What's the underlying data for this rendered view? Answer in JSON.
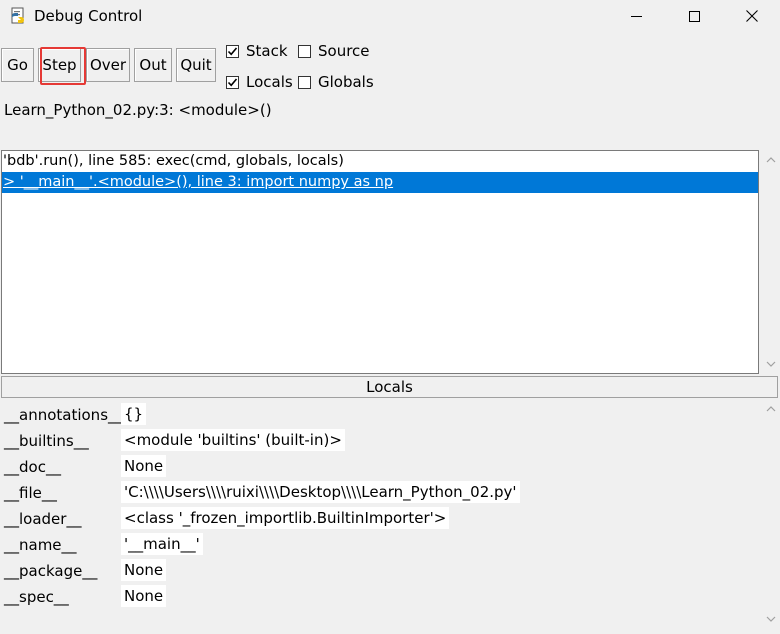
{
  "window": {
    "title": "Debug Control",
    "controls": [
      "minimize",
      "maximize",
      "close"
    ]
  },
  "toolbar": {
    "buttons": [
      {
        "id": "go",
        "label": "Go"
      },
      {
        "id": "step",
        "label": "Step",
        "highlighted": true
      },
      {
        "id": "over",
        "label": "Over"
      },
      {
        "id": "out",
        "label": "Out"
      },
      {
        "id": "quit",
        "label": "Quit"
      }
    ],
    "checkboxes": [
      {
        "id": "stack",
        "label": "Stack",
        "checked": true
      },
      {
        "id": "source",
        "label": "Source",
        "checked": false
      },
      {
        "id": "locals",
        "label": "Locals",
        "checked": true
      },
      {
        "id": "globals",
        "label": "Globals",
        "checked": false
      }
    ]
  },
  "status": "Learn_Python_02.py:3: <module>()",
  "stack": [
    {
      "text": "'bdb'.run(), line 585: exec(cmd, globals, locals)",
      "selected": false
    },
    {
      "text": "> '__main__'.<module>(), line 3: import numpy as np",
      "selected": true
    }
  ],
  "locals": {
    "header": "Locals",
    "variables": [
      {
        "name": "__annotations__",
        "value": "{}"
      },
      {
        "name": "__builtins__",
        "value": "<module 'builtins' (built-in)>"
      },
      {
        "name": "__doc__",
        "value": "None"
      },
      {
        "name": "__file__",
        "value": "'C:\\\\\\\\Users\\\\\\\\ruixi\\\\\\\\Desktop\\\\\\\\Learn_Python_02.py'"
      },
      {
        "name": "__loader__",
        "value": "<class '_frozen_importlib.BuiltinImporter'>"
      },
      {
        "name": "__name__",
        "value": "'__main__'"
      },
      {
        "name": "__package__",
        "value": "None"
      },
      {
        "name": "__spec__",
        "value": "None"
      }
    ]
  },
  "colors": {
    "selection": "#0078d7",
    "highlight_box": "#e53935",
    "background": "#f0f0f0"
  }
}
